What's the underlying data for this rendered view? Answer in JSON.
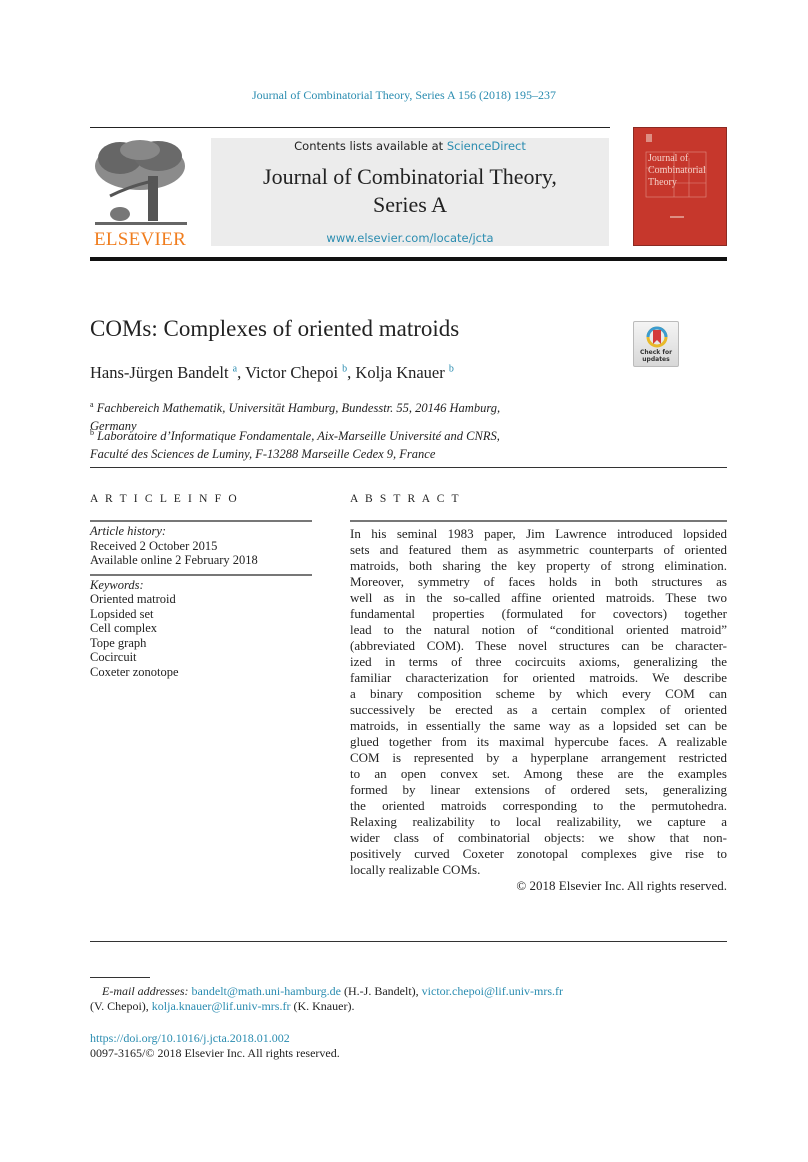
{
  "journal_reference": "Journal of Combinatorial Theory, Series A 156 (2018) 195–237",
  "header": {
    "contents_prefix": "Contents lists available at ",
    "contents_link": "ScienceDirect",
    "journal_name_line1": "Journal of Combinatorial Theory,",
    "journal_name_line2": "Series A",
    "journal_url": "www.elsevier.com/locate/jcta",
    "publisher_logo_text": "ELSEVIER",
    "cover_title_lines": [
      "Journal of",
      "Combinatorial",
      "Theory"
    ],
    "crossmark_label_line1": "Check for",
    "crossmark_label_line2": "updates"
  },
  "article": {
    "title": "COMs: Complexes of oriented matroids",
    "authors": [
      {
        "name": "Hans-Jürgen Bandelt",
        "affil": "a"
      },
      {
        "name": "Victor Chepoi",
        "affil": "b"
      },
      {
        "name": "Kolja Knauer",
        "affil": "b"
      }
    ],
    "affiliations": [
      {
        "mark": "a",
        "line1": "Fachbereich Mathematik, Universität Hamburg, Bundesstr. 55, 20146 Hamburg,",
        "line2": "Germany"
      },
      {
        "mark": "b",
        "line1": "Laboratoire d’Informatique Fondamentale, Aix-Marseille Université and CNRS,",
        "line2": "Faculté des Sciences de Luminy, F-13288 Marseille Cedex 9, France"
      }
    ]
  },
  "article_info": {
    "heading": "ARTICLE INFO",
    "history_label": "Article history:",
    "received": "Received 2 October 2015",
    "available": "Available online 2 February 2018",
    "keywords_label": "Keywords:",
    "keywords": [
      "Oriented matroid",
      "Lopsided set",
      "Cell complex",
      "Tope graph",
      "Cocircuit",
      "Coxeter zonotope"
    ]
  },
  "abstract": {
    "heading": "ABSTRACT",
    "lines": [
      "In his seminal 1983 paper, Jim Lawrence introduced lopsided",
      "sets and featured them as asymmetric counterparts of oriented",
      "matroids, both sharing the key property of strong elimination.",
      "Moreover, symmetry of faces holds in both structures as",
      "well as in the so-called affine oriented matroids. These two",
      "fundamental properties (formulated for covectors) together",
      "lead to the natural notion of “conditional oriented matroid”",
      "(abbreviated COM). These novel structures can be character-",
      "ized in terms of three cocircuits axioms, generalizing the",
      "familiar characterization for oriented matroids. We describe",
      "a binary composition scheme by which every COM can",
      "successively be erected as a certain complex of oriented",
      "matroids, in essentially the same way as a lopsided set can be",
      "glued together from its maximal hypercube faces. A realizable",
      "COM is represented by a hyperplane arrangement restricted",
      "to an open convex set. Among these are the examples",
      "formed by linear extensions of ordered sets, generalizing",
      "the oriented matroids corresponding to the permutohedra.",
      "Relaxing realizability to local realizability, we capture a",
      "wider class of combinatorial objects: we show that non-",
      "positively curved Coxeter zonotopal complexes give rise to",
      "locally realizable COMs."
    ],
    "copyright": "© 2018 Elsevier Inc. All rights reserved."
  },
  "footnote": {
    "label": "E-mail addresses:",
    "emails": [
      {
        "email": "bandelt@math.uni-hamburg.de",
        "who": "(H.-J. Bandelt),"
      },
      {
        "email": "victor.chepoi@lif.univ-mrs.fr",
        "who": "(V. Chepoi),"
      },
      {
        "email": "kolja.knauer@lif.univ-mrs.fr",
        "who": "(K. Knauer)."
      }
    ]
  },
  "doi": "https://doi.org/10.1016/j.jcta.2018.01.002",
  "issn_line": "0097-3165/© 2018 Elsevier Inc. All rights reserved.",
  "colors": {
    "link": "#2a8cb0",
    "elsevier_orange": "#f07d1e",
    "cover_red": "#c6372c",
    "header_gray": "#ececec"
  }
}
